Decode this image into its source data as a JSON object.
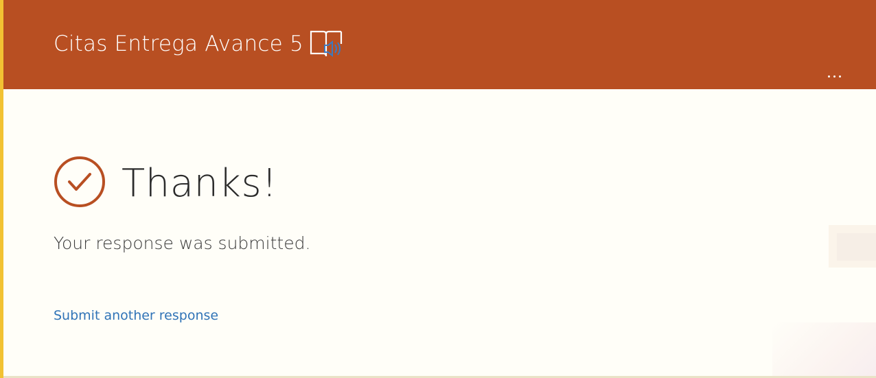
{
  "header": {
    "title": "Citas Entrega Avance 5",
    "reader_icon": "immersive-reader-icon",
    "more_icon": "more-options-icon",
    "background_color": "#b84f22"
  },
  "confirmation": {
    "icon": "checkmark-circle-icon",
    "title": "Thanks!",
    "message": "Your response was submitted.",
    "link_label": "Submit another response"
  },
  "colors": {
    "accent": "#b84f22",
    "link": "#2f73b7",
    "page_background": "#fffef8",
    "edge": "#f2c233"
  }
}
